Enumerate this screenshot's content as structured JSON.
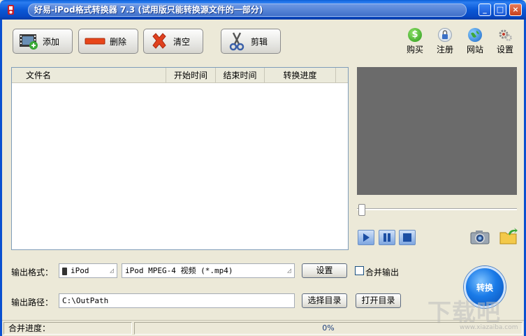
{
  "window": {
    "title": "好易-iPod格式转换器 7.3 (试用版只能转换源文件的一部分)",
    "minimize_label": "_",
    "maximize_label": "□",
    "close_label": "×"
  },
  "toolbar": {
    "add_label": "添加",
    "delete_label": "删除",
    "clear_label": "清空",
    "cut_label": "剪辑"
  },
  "right_tools": {
    "buy_label": "购买",
    "register_label": "注册",
    "website_label": "网站",
    "settings_label": "设置"
  },
  "file_list": {
    "columns": [
      "文件名",
      "开始时间",
      "结束时间",
      "转换进度"
    ]
  },
  "output": {
    "format_label": "输出格式：",
    "device_value": "iPod",
    "format_value": "iPod MPEG-4 视频 (*.mp4)",
    "settings_button": "设置",
    "merge_label": "合并输出",
    "path_label": "输出路径：",
    "path_value": "C:\\OutPath",
    "choose_dir_button": "选择目录",
    "open_dir_button": "打开目录"
  },
  "convert": {
    "label": "转换"
  },
  "status": {
    "merge_progress_label": "合并进度：",
    "progress_value": "0%"
  },
  "watermark": {
    "brand": "下载吧",
    "url": "www.xiazaiba.com"
  },
  "colors": {
    "titlebar": "#0a58d6",
    "window_bg": "#ece9d8",
    "preview_bg": "#6b6b6b",
    "delete_red": "#e8461a",
    "clear_red": "#e0411e"
  }
}
